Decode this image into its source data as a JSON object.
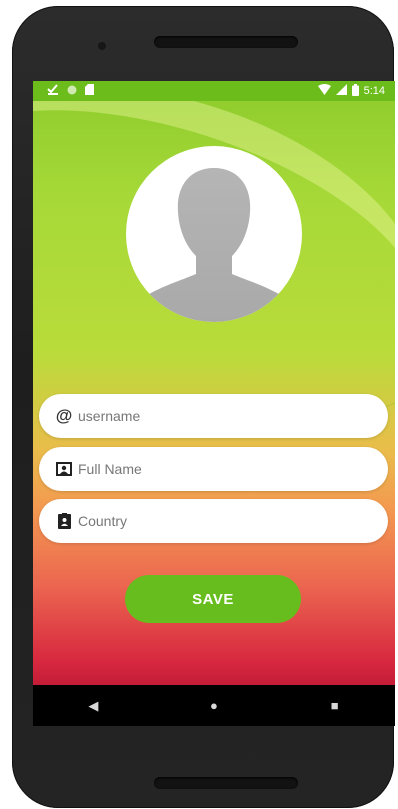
{
  "status_bar": {
    "time": "5:14",
    "left_icons": [
      "download-done-icon",
      "circle-icon",
      "sd-card-icon"
    ],
    "right_icons": [
      "wifi-icon",
      "signal-icon",
      "battery-icon"
    ]
  },
  "form": {
    "username": {
      "icon": "at-icon",
      "glyph": "@",
      "placeholder": "username",
      "value": ""
    },
    "full_name": {
      "icon": "contact-card-icon",
      "placeholder": "Full Name",
      "value": ""
    },
    "country": {
      "icon": "badge-icon",
      "placeholder": "Country",
      "value": ""
    },
    "save_label": "SAVE"
  },
  "nav": {
    "back_glyph": "◀",
    "home_glyph": "●",
    "recents_glyph": "■"
  },
  "colors": {
    "accent": "#67bd1e",
    "status_bar": "#6cbd1c"
  }
}
